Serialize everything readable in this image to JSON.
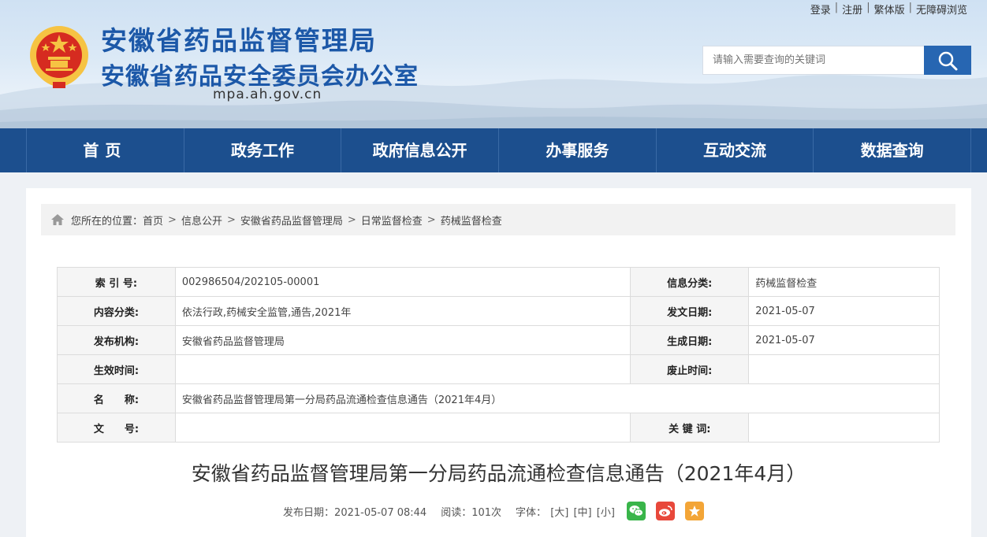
{
  "top_links": [
    "登录",
    "注册",
    "繁体版",
    "无障碍浏览"
  ],
  "header": {
    "title_line1": "安徽省药品监督管理局",
    "title_line2": "安徽省药品安全委员会办公室",
    "domain": "mpa.ah.gov.cn",
    "search_placeholder": "请输入需要查询的关键词"
  },
  "nav": [
    "首页",
    "政务工作",
    "政府信息公开",
    "办事服务",
    "互动交流",
    "数据查询"
  ],
  "breadcrumb": {
    "prefix": "您所在的位置：",
    "items": [
      "首页",
      "信息公开",
      "安徽省药品监督管理局",
      "日常监督检查",
      "药械监督检查"
    ],
    "separator": ">"
  },
  "meta_table": {
    "index_label": "索 引 号:",
    "index_value": "002986504/202105-00001",
    "category_label": "信息分类:",
    "category_value": "药械监督检查",
    "content_label": "内容分类:",
    "content_value": "依法行政,药械安全监管,通告,2021年",
    "issue_date_label": "发文日期:",
    "issue_date_value": "2021-05-07",
    "publisher_label": "发布机构:",
    "publisher_value": "安徽省药品监督管理局",
    "gen_date_label": "生成日期:",
    "gen_date_value": "2021-05-07",
    "effective_label": "生效时间:",
    "effective_value": "",
    "abolish_label": "废止时间:",
    "abolish_value": "",
    "name_label": "名　　称:",
    "name_value": "安徽省药品监督管理局第一分局药品流通检查信息通告（2021年4月）",
    "docno_label": "文　　号:",
    "docno_value": "",
    "keywords_label": "关 键 词:",
    "keywords_value": ""
  },
  "article": {
    "title": "安徽省药品监督管理局第一分局药品流通检查信息通告（2021年4月）",
    "publish": "发布日期：2021-05-07 08:44",
    "reads": "阅读：101次",
    "font_label": "字体：",
    "font_large": "[大]",
    "font_medium": "[中]",
    "font_small": "[小]"
  },
  "colors": {
    "brand_blue": "#1c58a8",
    "nav_bg": "#1c4f8e",
    "search_btn": "#2766b2"
  }
}
